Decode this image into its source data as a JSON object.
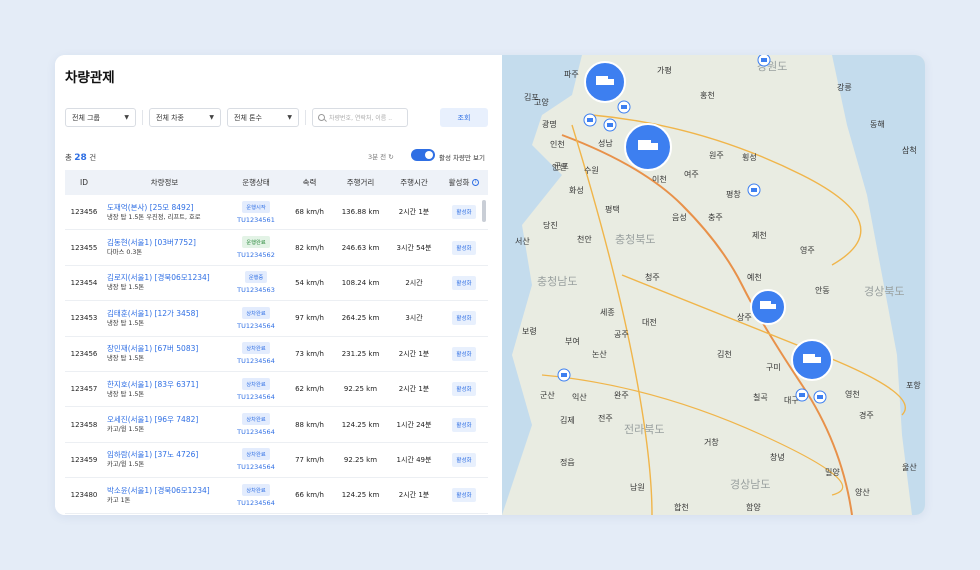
{
  "page": {
    "title": "차량관제"
  },
  "filters": {
    "group": "전체 그룹",
    "type": "전체 차종",
    "tonnage": "전체 톤수",
    "search_placeholder": "차량번호, 연락처, 이름 ..",
    "query_button": "조회"
  },
  "summary": {
    "total_prefix": "총",
    "total_count": "28",
    "total_suffix": "건",
    "refresh": "3분 전",
    "toggle_label": "활성 차량만 보기"
  },
  "table": {
    "headers": {
      "id": "ID",
      "info": "차량정보",
      "status": "운행상태",
      "speed": "속력",
      "distance": "주행거리",
      "time": "주행시간",
      "active": "활성화"
    },
    "rows": [
      {
        "id": "123456",
        "name": "도재억(본사)",
        "plate": "[25모 8492]",
        "desc": "냉장 탑 1.5톤 우진정, 리프트, 호로",
        "status": "운행시작",
        "status_kind": "run",
        "tu": "TU1234561",
        "speed": "68 km/h",
        "distance": "136.88 km",
        "time": "2시간 1분",
        "active": "활성화"
      },
      {
        "id": "123455",
        "name": "김동현(서울1)",
        "plate": "[03버7752]",
        "desc": "다마스 0.3톤",
        "status": "운행완료",
        "status_kind": "done",
        "tu": "TU1234562",
        "speed": "82 km/h",
        "distance": "246.63 km",
        "time": "3시간 54분",
        "active": "활성화"
      },
      {
        "id": "123454",
        "name": "김로지(서울1)",
        "plate": "[경북06모1234]",
        "desc": "냉장 탑 1.5톤",
        "status": "운행중",
        "status_kind": "run",
        "tu": "TU1234563",
        "speed": "54 km/h",
        "distance": "108.24 km",
        "time": "2시간",
        "active": "활성화"
      },
      {
        "id": "123453",
        "name": "김태훈(서울1)",
        "plate": "[12가 3458]",
        "desc": "냉장 탑 1.5톤",
        "status": "상차완료",
        "status_kind": "ld",
        "tu": "TU1234564",
        "speed": "97 km/h",
        "distance": "264.25 km",
        "time": "3시간",
        "active": "활성화"
      },
      {
        "id": "123456",
        "name": "장민재(서울1)",
        "plate": "[67버 5083]",
        "desc": "냉장 탑 1.5톤",
        "status": "상차완료",
        "status_kind": "ld",
        "tu": "TU1234564",
        "speed": "73 km/h",
        "distance": "231.25 km",
        "time": "2시간 1분",
        "active": "활성화"
      },
      {
        "id": "123457",
        "name": "한지호(서울1)",
        "plate": "[83우 6371]",
        "desc": "냉장 탑 1.5톤",
        "status": "상차완료",
        "status_kind": "ld",
        "tu": "TU1234564",
        "speed": "62 km/h",
        "distance": "92.25 km",
        "time": "2시간 1분",
        "active": "활성화"
      },
      {
        "id": "123458",
        "name": "오세진(서울1)",
        "plate": "[96우 7482]",
        "desc": "카고/윙 1.5톤",
        "status": "상차완료",
        "status_kind": "ld",
        "tu": "TU1234564",
        "speed": "88 km/h",
        "distance": "124.25 km",
        "time": "1시간 24분",
        "active": "활성화"
      },
      {
        "id": "123459",
        "name": "임하람(서울1)",
        "plate": "[37노 4726]",
        "desc": "카고/윙 1.5톤",
        "status": "상차완료",
        "status_kind": "ld",
        "tu": "TU1234564",
        "speed": "77 km/h",
        "distance": "92.25 km",
        "time": "1시간 49분",
        "active": "활성화"
      },
      {
        "id": "123480",
        "name": "박소윤(서울1)",
        "plate": "[경북06모1234]",
        "desc": "카고 1톤",
        "status": "상차완료",
        "status_kind": "ld",
        "tu": "TU1234564",
        "speed": "66 km/h",
        "distance": "124.25 km",
        "time": "2시간 1분",
        "active": "활성화"
      }
    ]
  },
  "map": {
    "labels": [
      "강원도",
      "파주",
      "가평",
      "김포",
      "고양",
      "홍천",
      "강릉",
      "광명",
      "인천",
      "성남",
      "횡성",
      "원주",
      "평창",
      "동해",
      "삼척",
      "안산",
      "수원",
      "이천",
      "여주",
      "군포",
      "화성",
      "평택",
      "제천",
      "음성",
      "충주",
      "당진",
      "서산",
      "천안",
      "충청북도",
      "영주",
      "청주",
      "충청남도",
      "예천",
      "안동",
      "경상북도",
      "세종",
      "대전",
      "공주",
      "보령",
      "부여",
      "상주",
      "논산",
      "김천",
      "구미",
      "익산",
      "포항",
      "군산",
      "완주",
      "칠곡",
      "대구",
      "영천",
      "경주",
      "김제",
      "전주",
      "전라북도",
      "거창",
      "울산",
      "정읍",
      "창녕",
      "밀양",
      "양산",
      "남원",
      "경상남도",
      "함양",
      "합천"
    ],
    "colors": {
      "pin": "#3d7ff0",
      "water": "#c4dced",
      "land": "#e9ece2",
      "road": "#f0b54a",
      "highway": "#e8914a"
    }
  }
}
